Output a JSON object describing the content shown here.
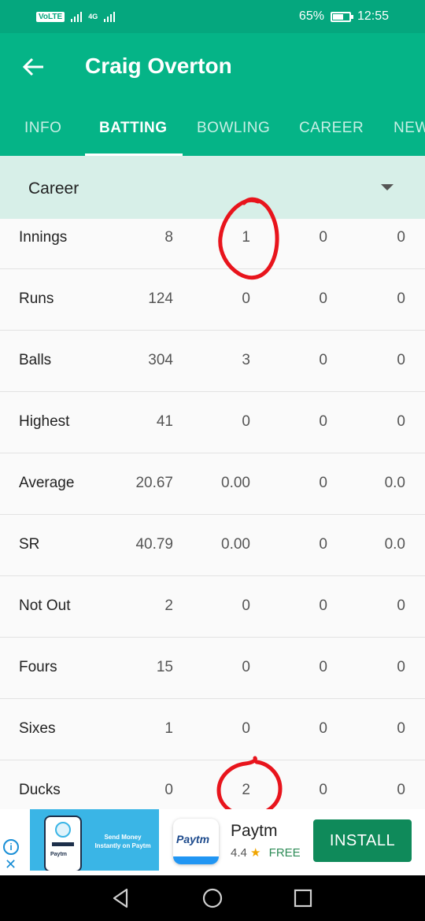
{
  "status_bar": {
    "network": "VoLTE",
    "network_type": "4G",
    "battery": "65%",
    "battery_level": 0.65,
    "time": "12:55"
  },
  "header": {
    "title": "Craig Overton"
  },
  "tabs": [
    {
      "label": "INFO"
    },
    {
      "label": "BATTING"
    },
    {
      "label": "BOWLING"
    },
    {
      "label": "CAREER"
    },
    {
      "label": "NEWS"
    }
  ],
  "filter": {
    "selected": "Career"
  },
  "stats": [
    {
      "label": "Innings",
      "values": [
        "8",
        "1",
        "0",
        "0"
      ]
    },
    {
      "label": "Runs",
      "values": [
        "124",
        "0",
        "0",
        "0"
      ]
    },
    {
      "label": "Balls",
      "values": [
        "304",
        "3",
        "0",
        "0"
      ]
    },
    {
      "label": "Highest",
      "values": [
        "41",
        "0",
        "0",
        "0"
      ]
    },
    {
      "label": "Average",
      "values": [
        "20.67",
        "0.00",
        "0",
        "0.0"
      ]
    },
    {
      "label": "SR",
      "values": [
        "40.79",
        "0.00",
        "0",
        "0.0"
      ]
    },
    {
      "label": "Not Out",
      "values": [
        "2",
        "0",
        "0",
        "0"
      ]
    },
    {
      "label": "Fours",
      "values": [
        "15",
        "0",
        "0",
        "0"
      ]
    },
    {
      "label": "Sixes",
      "values": [
        "1",
        "0",
        "0",
        "0"
      ]
    },
    {
      "label": "Ducks",
      "values": [
        "0",
        "2",
        "0",
        "0"
      ]
    }
  ],
  "ad": {
    "banner_brand": "Paytm",
    "banner_text": "Send Money Instantly on Paytm",
    "logo_text": "Paytm",
    "name": "Paytm",
    "rating": "4.4",
    "price": "FREE",
    "install_label": "INSTALL",
    "info_icon": "i",
    "close_icon": "✕"
  },
  "colors": {
    "accent": "#05b487",
    "status_bar": "#05a77e",
    "filter_bg": "#d7efe8",
    "annotation": "#e8141c",
    "install": "#0f8a5a"
  }
}
